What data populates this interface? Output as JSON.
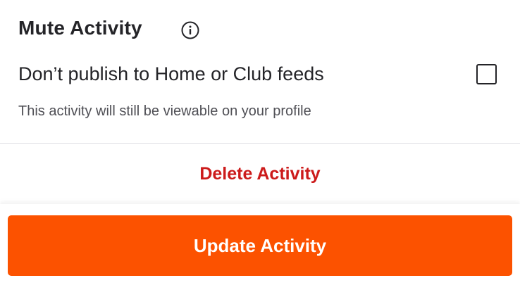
{
  "mute": {
    "title": "Mute Activity",
    "info_icon": "info-icon",
    "option_label": "Don’t publish to Home or Club feeds",
    "option_checked": false,
    "option_help": "This activity will still be viewable on your profile"
  },
  "actions": {
    "delete_label": "Delete Activity",
    "update_label": "Update Activity"
  },
  "colors": {
    "delete_text": "#cc1b1b",
    "primary_button": "#fc5200",
    "primary_button_text": "#ffffff"
  }
}
